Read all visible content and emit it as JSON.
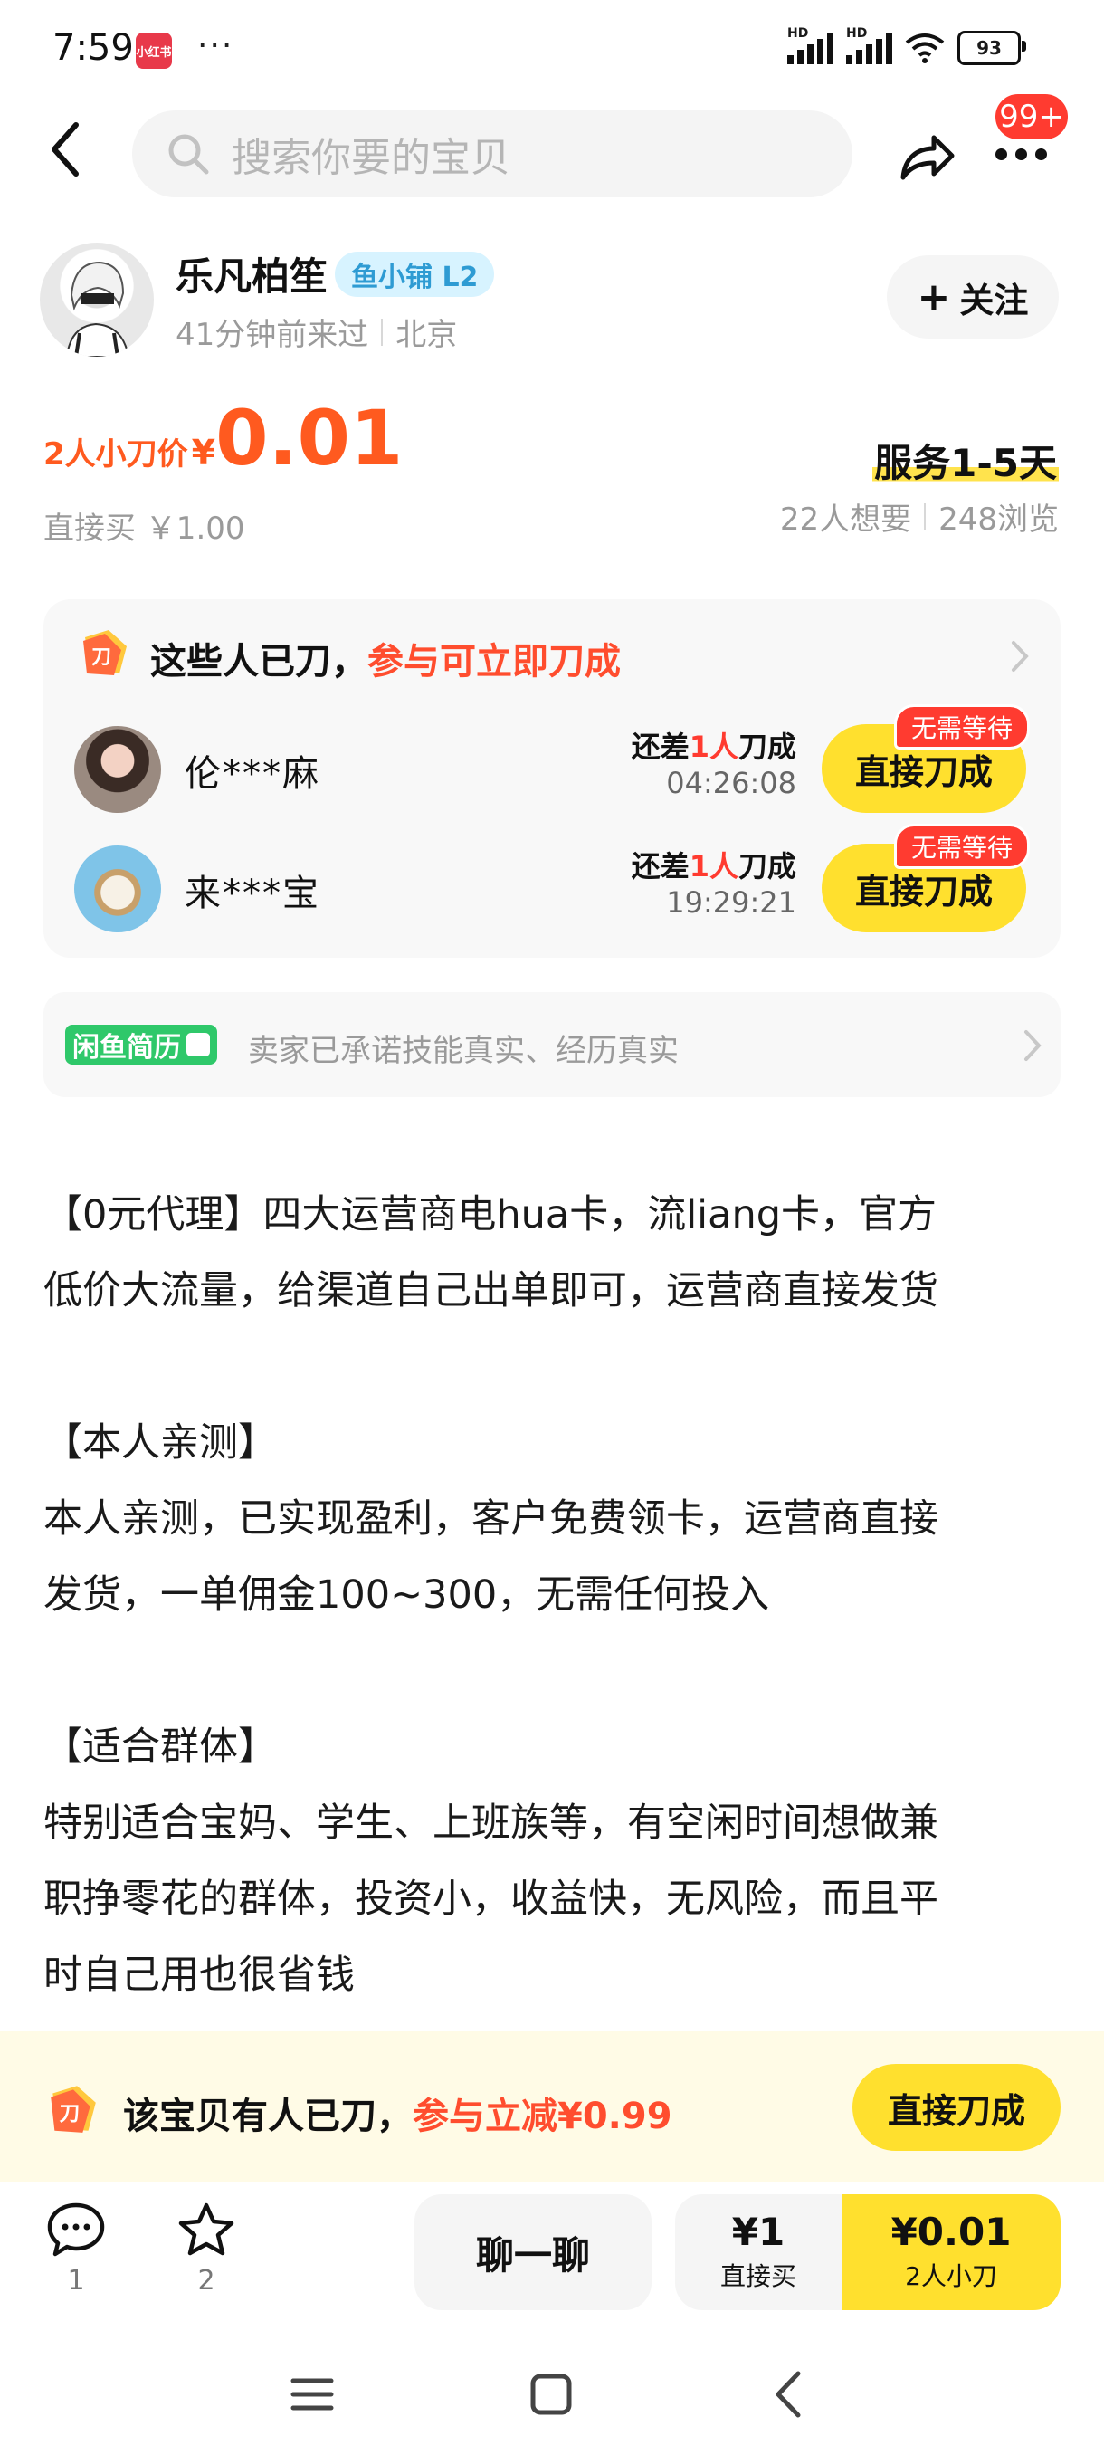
{
  "status_bar": {
    "time": "7:59",
    "app_badge": "小红书",
    "dots": "···",
    "network_label": "HD",
    "battery": "93"
  },
  "nav": {
    "search_placeholder": "搜索你要的宝贝",
    "message_badge": "99+"
  },
  "seller": {
    "name": "乐凡柏笙",
    "shop_badge": "鱼小铺 L2",
    "last_seen": "41分钟前来过",
    "location": "北京",
    "follow_label": "关注"
  },
  "price": {
    "label": "2人小刀价",
    "currency": "¥",
    "value": "0.01",
    "direct_buy": "直接买 ￥1.00",
    "service": "服务1-5天",
    "wants": "22人想要",
    "views": "248浏览"
  },
  "cut_card": {
    "title_prefix": "这些人已刀，",
    "title_highlight": "参与可立即刀成",
    "icon_char": "刀",
    "helpers": [
      {
        "name": "伦***麻",
        "need_prefix": "还差",
        "need_count": "1人",
        "need_suffix": "刀成",
        "time": "04:26:08",
        "button": "直接刀成",
        "badge": "无需等待"
      },
      {
        "name": "来***宝",
        "need_prefix": "还差",
        "need_count": "1人",
        "need_suffix": "刀成",
        "time": "19:29:21",
        "button": "直接刀成",
        "badge": "无需等待"
      }
    ]
  },
  "resume": {
    "tag": "闲鱼简历",
    "text": "卖家已承诺技能真实、经历真实"
  },
  "description": [
    "【0元代理】四大运营商电hua卡，流liang卡，官方\n低价大流量，给渠道自己出单即可，运营商直接发货",
    "",
    "【本人亲测】",
    "本人亲测，已实现盈利，客户免费领卡，运营商直接\n发货，一单佣金100~300，无需任何投入",
    "",
    "【适合群体】",
    "特别适合宝妈、学生、上班族等，有空闲时间想做兼\n职挣零花的群体，投资小，收益快，无风险，而且平\n时自己用也很省钱"
  ],
  "banner": {
    "text_prefix": "该宝贝有人已刀，",
    "text_highlight": "参与立减¥0.99",
    "button": "直接刀成"
  },
  "bottom": {
    "comments_count": "1",
    "favorites_count": "2",
    "chat_label": "聊一聊",
    "direct_price": "¥1",
    "direct_label": "直接买",
    "cut_price": "¥0.01",
    "cut_label": "2人小刀"
  },
  "colors": {
    "accent_yellow": "#ffe02e",
    "price_orange": "#ff5a1f",
    "highlight_red": "#ff4d2e",
    "badge_red": "#ff3b30"
  }
}
